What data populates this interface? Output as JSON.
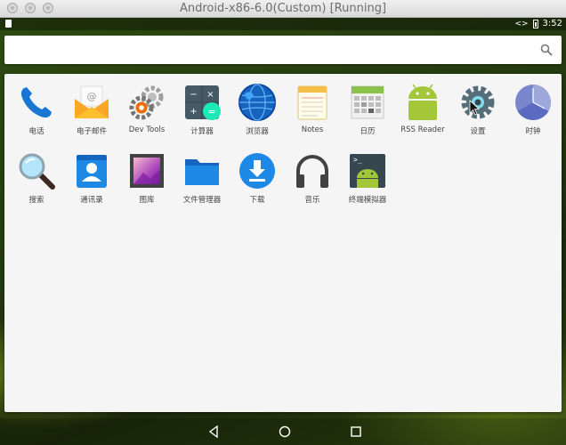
{
  "window": {
    "title": "Android-x86-6.0(Custom) [Running]"
  },
  "status_bar": {
    "code_indicator": "<>",
    "time": "3:52"
  },
  "search": {
    "value": "",
    "placeholder": ""
  },
  "apps": [
    {
      "label": "电话",
      "icon": "phone-icon"
    },
    {
      "label": "电子邮件",
      "icon": "email-icon"
    },
    {
      "label": "Dev Tools",
      "icon": "dev-tools-icon"
    },
    {
      "label": "计算器",
      "icon": "calculator-icon"
    },
    {
      "label": "浏览器",
      "icon": "browser-icon"
    },
    {
      "label": "Notes",
      "icon": "notes-icon"
    },
    {
      "label": "日历",
      "icon": "calendar-icon"
    },
    {
      "label": "RSS Reader",
      "icon": "rss-reader-icon"
    },
    {
      "label": "设置",
      "icon": "settings-icon"
    },
    {
      "label": "时钟",
      "icon": "clock-icon"
    },
    {
      "label": "搜索",
      "icon": "search-app-icon"
    },
    {
      "label": "通讯录",
      "icon": "contacts-icon"
    },
    {
      "label": "图库",
      "icon": "gallery-icon"
    },
    {
      "label": "文件管理器",
      "icon": "file-manager-icon"
    },
    {
      "label": "下载",
      "icon": "download-icon"
    },
    {
      "label": "音乐",
      "icon": "music-icon"
    },
    {
      "label": "终端模拟器",
      "icon": "terminal-icon"
    }
  ],
  "nav": {
    "back": "back-icon",
    "home": "home-icon",
    "recents": "recents-icon"
  },
  "colors": {
    "android_green": "#a4c639",
    "accent_blue": "#1e88e5",
    "drawer_bg": "#f5f5f5"
  }
}
